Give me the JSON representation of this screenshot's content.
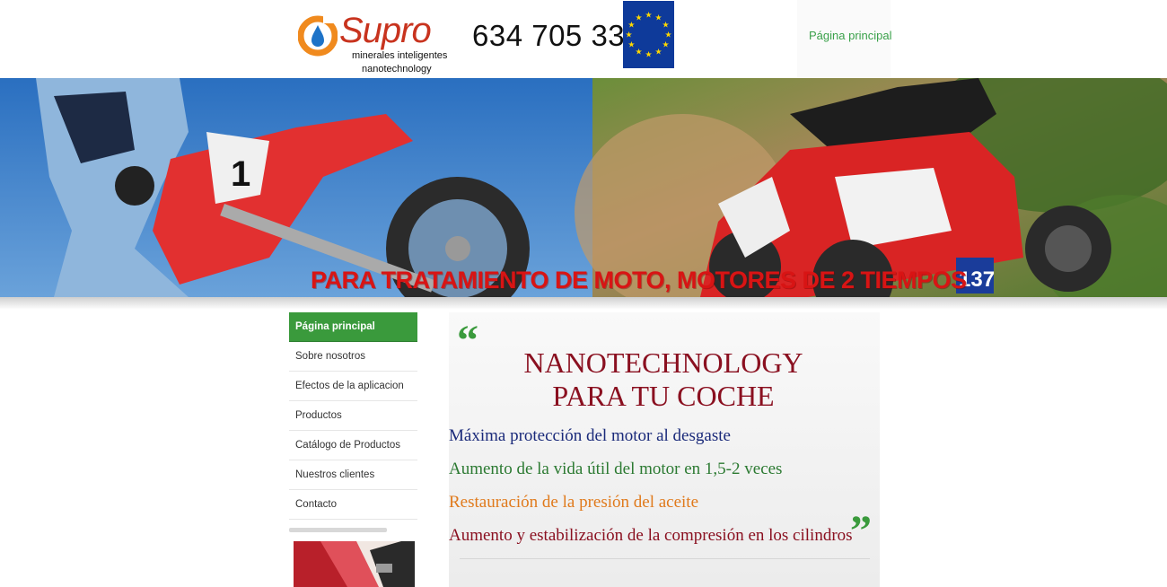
{
  "header": {
    "logo": {
      "name": "Supro",
      "tagline_line1": "minerales inteligentes",
      "tagline_line2": "nanotechnology",
      "icon": "supro-drop-logo-icon",
      "colors": {
        "ring": "#f08a1e",
        "drop": "#1e73c8",
        "name": "#c8331e"
      }
    },
    "phone": "634 705 332",
    "flag_icon": "eu-flag-icon",
    "nav": {
      "home_label": "Página principal"
    }
  },
  "hero": {
    "caption": "PARA TRATAMIENTO DE MOTO, MOTORES DE 2 TIEMPOS",
    "image": "motocross-and-quad-photo",
    "bike_numbers": {
      "left": "1",
      "right": "137"
    }
  },
  "sidebar": {
    "items": [
      {
        "label": "Página principal",
        "active": true
      },
      {
        "label": "Sobre nosotros",
        "active": false
      },
      {
        "label": "Efectos de la aplicacion",
        "active": false
      },
      {
        "label": "Productos",
        "active": false
      },
      {
        "label": "Catálogo de Productos",
        "active": false
      },
      {
        "label": "Nuestros clientes",
        "active": false
      },
      {
        "label": "Contacto",
        "active": false
      }
    ],
    "thumbnail": "red-car-photo"
  },
  "content": {
    "quote_open": "“",
    "quote_close": "”",
    "headline_line1": "NANOTECHNOLOGY",
    "headline_line2": "PARA TU COCHE",
    "benefits": [
      {
        "text": "Máxima protección del motor al desgaste",
        "color": "#1a2a7a"
      },
      {
        "text": "Aumento de la vida útil del motor en 1,5-2 veces",
        "color": "#2c7a32"
      },
      {
        "text": "Restauración de la presión del aceite",
        "color": "#e07a1c"
      },
      {
        "text": "Aumento y estabilización de la compresión en los cilindros",
        "color": "#8a1020"
      }
    ]
  },
  "colors": {
    "accent_green": "#3a9a3c",
    "headline_red": "#8a1020",
    "caption_red": "#d81414"
  }
}
